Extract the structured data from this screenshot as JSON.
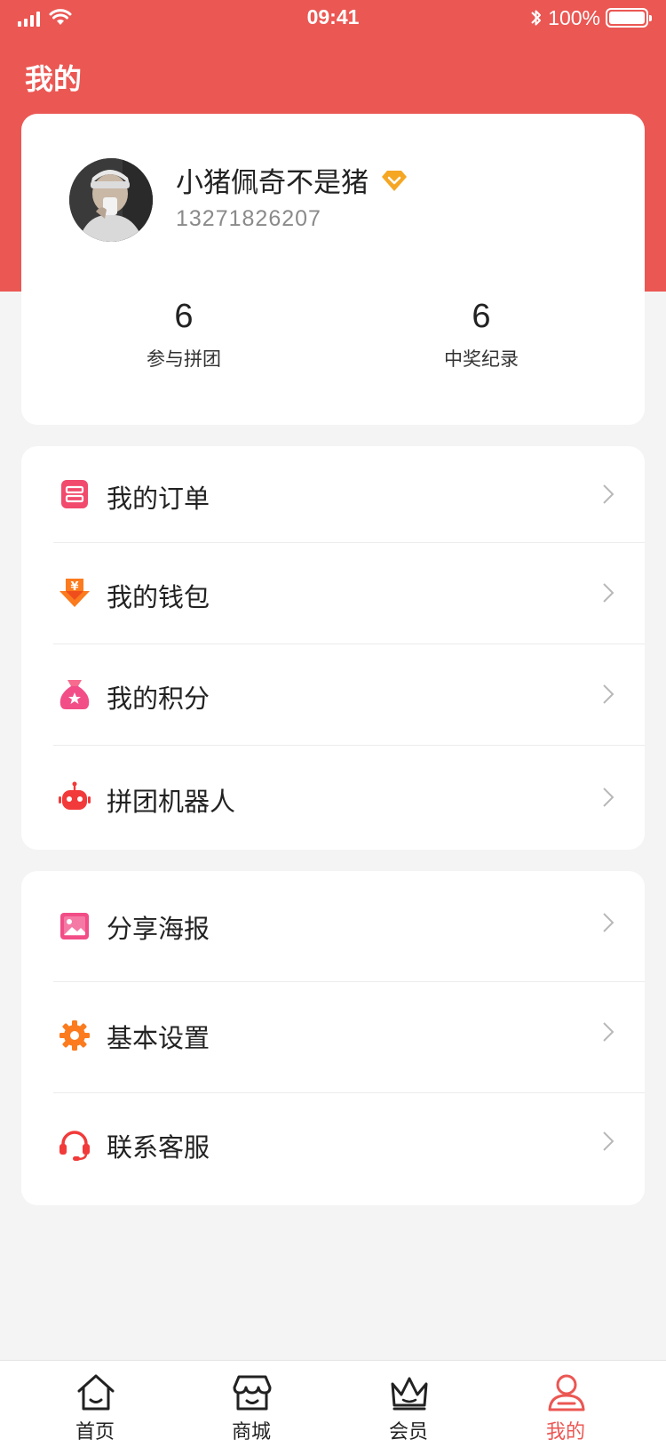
{
  "status_bar": {
    "time": "09:41",
    "battery": "100%"
  },
  "page": {
    "title": "我的"
  },
  "profile": {
    "name": "小猪佩奇不是猪",
    "phone": "13271826207",
    "stats": [
      {
        "value": "6",
        "label": "参与拼团"
      },
      {
        "value": "6",
        "label": "中奖纪录"
      }
    ]
  },
  "menu_group_1": [
    {
      "label": "我的订单",
      "icon": "order-icon"
    },
    {
      "label": "我的钱包",
      "icon": "wallet-icon"
    },
    {
      "label": "我的积分",
      "icon": "points-bag-icon"
    },
    {
      "label": "拼团机器人",
      "icon": "robot-icon"
    }
  ],
  "menu_group_2": [
    {
      "label": "分享海报",
      "icon": "poster-icon"
    },
    {
      "label": "基本设置",
      "icon": "settings-gear-icon"
    },
    {
      "label": "联系客服",
      "icon": "headset-icon"
    }
  ],
  "tabbar": {
    "items": [
      {
        "label": "首页",
        "icon": "home-icon"
      },
      {
        "label": "商城",
        "icon": "store-icon"
      },
      {
        "label": "会员",
        "icon": "crown-icon"
      },
      {
        "label": "我的",
        "icon": "user-icon"
      }
    ],
    "active_index": 3
  },
  "colors": {
    "brand": "#eb5753",
    "vip_badge": "#f5a623",
    "background": "#f4f4f4"
  }
}
